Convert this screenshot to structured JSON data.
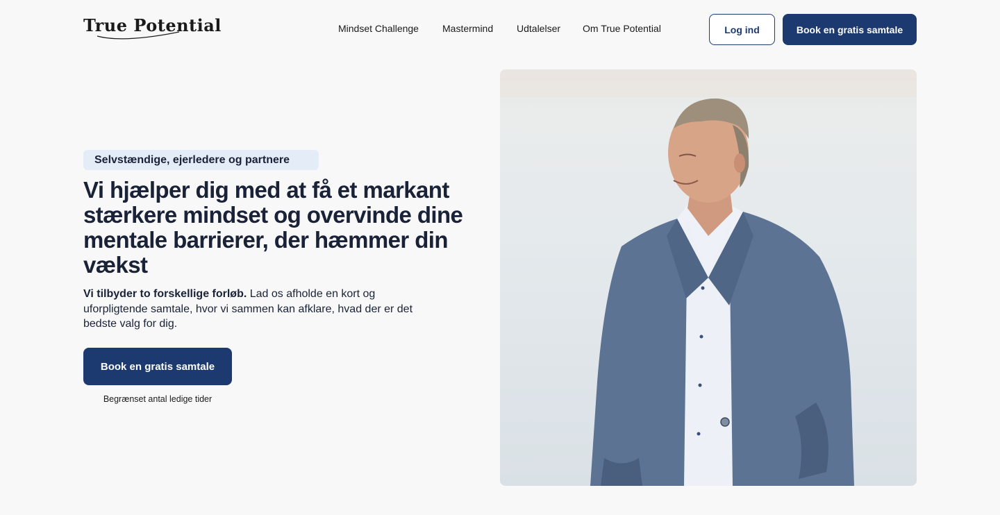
{
  "brand": {
    "logo_text": "True Potential"
  },
  "nav": {
    "items": [
      {
        "label": "Mindset Challenge"
      },
      {
        "label": "Mastermind"
      },
      {
        "label": "Udtalelser"
      },
      {
        "label": "Om True Potential"
      }
    ],
    "login_label": "Log ind",
    "cta_label": "Book en gratis samtale"
  },
  "hero": {
    "badge": "Selvstændige, ejerledere og partnere",
    "headline_bold": "Vi hjælper dig med at få et markant stærkere mindset",
    "headline_rest": " og overvinde dine mentale barrierer, der hæmmer din vækst",
    "lead_bold": "Vi tilbyder to forskellige forløb.",
    "lead_rest": " Lad os afholde en kort og uforpligtende samtale, hvor vi sammen kan afklare, hvad der er det bedste valg for dig.",
    "cta_label": "Book en gratis samtale",
    "cta_note": "Begrænset antal ledige tider"
  },
  "colors": {
    "primary": "#1d3a70",
    "badge_bg": "#e4ecf8",
    "text": "#1a2238",
    "page_bg": "#f8f8f8"
  }
}
